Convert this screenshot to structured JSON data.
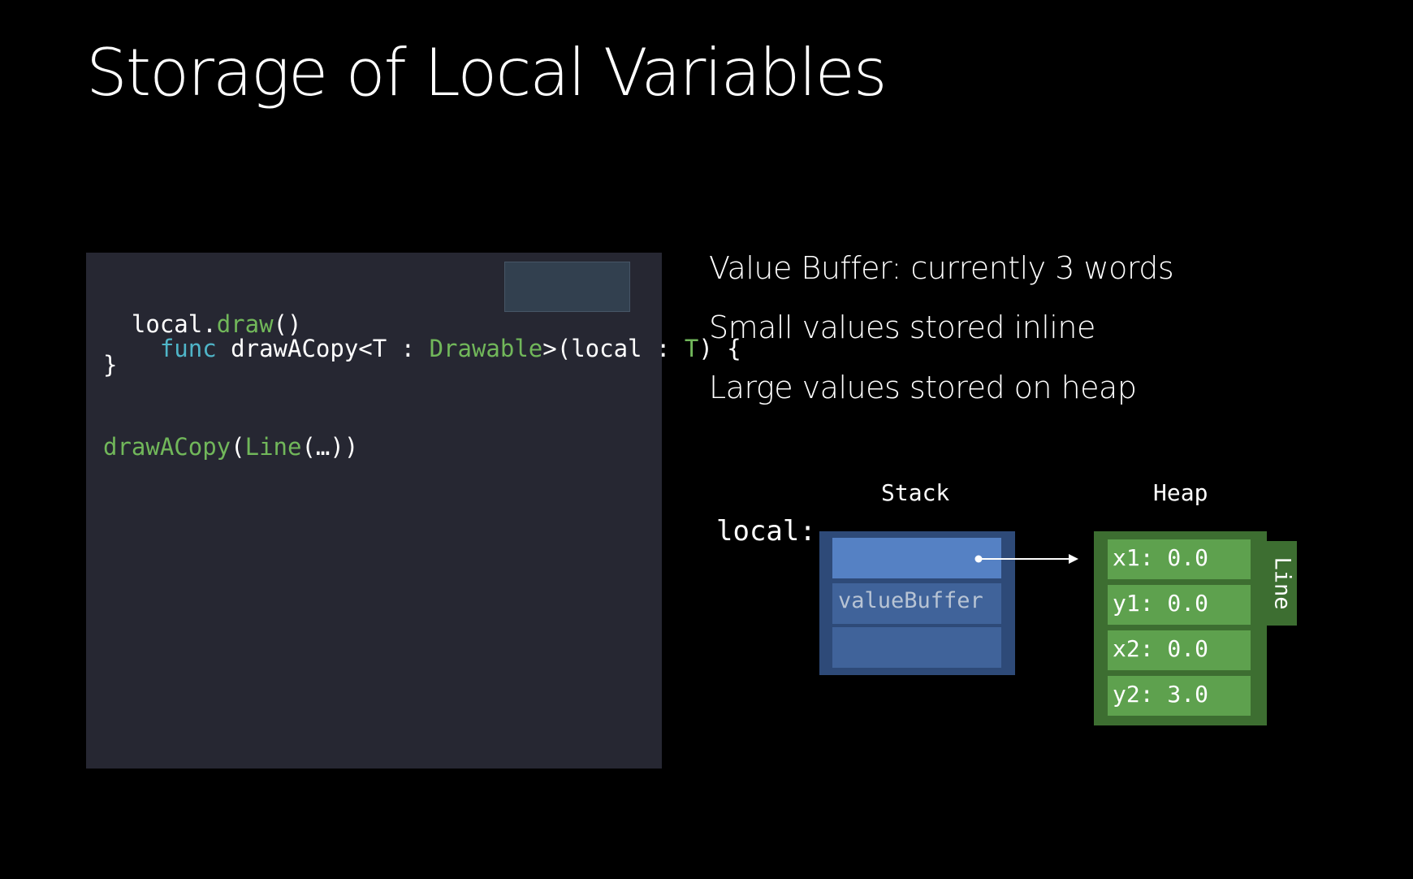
{
  "title": "Storage of Local Variables",
  "code": {
    "line1": {
      "func": "func",
      "name": " drawACopy<T : ",
      "type": "Drawable",
      "after_type": ">(",
      "param": "local : ",
      "param_type": "T",
      "close": ") {"
    },
    "line2": {
      "indent": "  ",
      "obj": "local.",
      "method": "draw",
      "parens": "()"
    },
    "line3": "}",
    "line5": {
      "call": "drawACopy",
      "open": "(",
      "type": "Line",
      "args": "(…))"
    }
  },
  "bullets": [
    "Value Buffer: currently 3 words",
    "Small values stored inline",
    "Large values stored on heap"
  ],
  "diagram": {
    "stack_label": "Stack",
    "heap_label": "Heap",
    "local_label": "local:",
    "value_buffer_label": "valueBuffer",
    "line_label": "Line",
    "heap_fields": [
      "x1: 0.0",
      "y1: 0.0",
      "x2: 0.0",
      "y2: 3.0"
    ]
  },
  "colors": {
    "background": "#000000",
    "code_panel": "#262732",
    "keyword": "#4fb5c8",
    "type": "#71b75a",
    "stack_frame": "#2e4a78",
    "stack_cell_active": "#5581c4",
    "stack_cell": "#40639a",
    "heap_frame": "#3d6e31",
    "heap_cell": "#5ea14e"
  }
}
